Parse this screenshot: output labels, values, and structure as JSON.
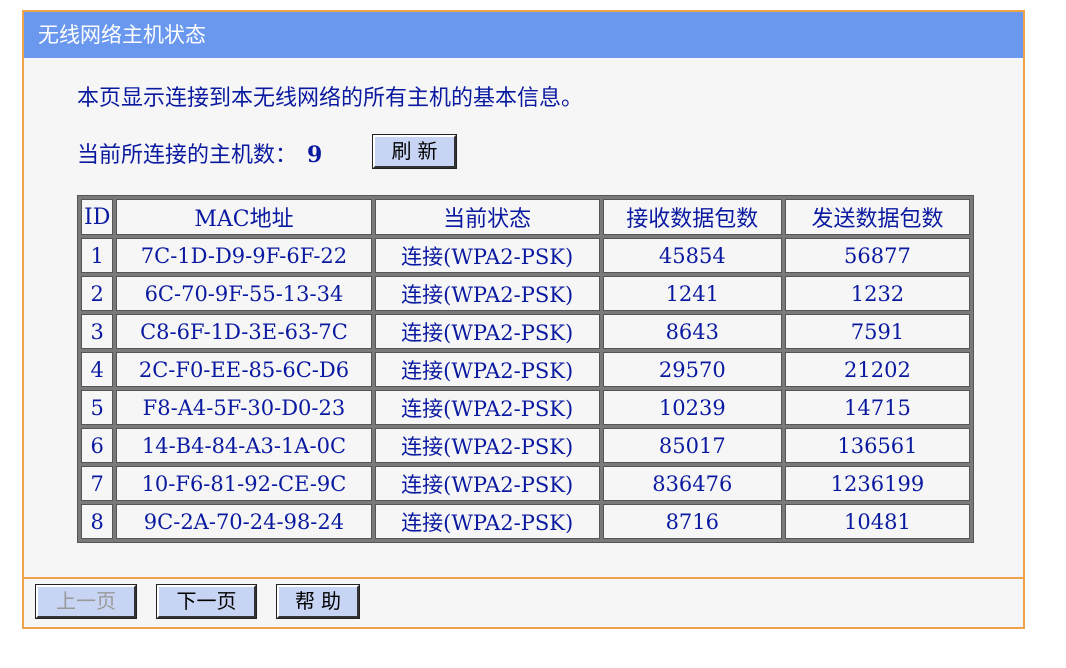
{
  "window": {
    "title": "无线网络主机状态"
  },
  "intro": {
    "description": "本页显示连接到本无线网络的所有主机的基本信息。",
    "count_label": "当前所连接的主机数：",
    "count_value": "9",
    "refresh_label": "刷新"
  },
  "table": {
    "headers": [
      "ID",
      "MAC地址",
      "当前状态",
      "接收数据包数",
      "发送数据包数"
    ],
    "rows": [
      [
        "1",
        "7C-1D-D9-9F-6F-22",
        "连接(WPA2-PSK)",
        "45854",
        "56877"
      ],
      [
        "2",
        "6C-70-9F-55-13-34",
        "连接(WPA2-PSK)",
        "1241",
        "1232"
      ],
      [
        "3",
        "C8-6F-1D-3E-63-7C",
        "连接(WPA2-PSK)",
        "8643",
        "7591"
      ],
      [
        "4",
        "2C-F0-EE-85-6C-D6",
        "连接(WPA2-PSK)",
        "29570",
        "21202"
      ],
      [
        "5",
        "F8-A4-5F-30-D0-23",
        "连接(WPA2-PSK)",
        "10239",
        "14715"
      ],
      [
        "6",
        "14-B4-84-A3-1A-0C",
        "连接(WPA2-PSK)",
        "85017",
        "136561"
      ],
      [
        "7",
        "10-F6-81-92-CE-9C",
        "连接(WPA2-PSK)",
        "836476",
        "1236199"
      ],
      [
        "8",
        "9C-2A-70-24-98-24",
        "连接(WPA2-PSK)",
        "8716",
        "10481"
      ]
    ]
  },
  "footer": {
    "prev_label": "上一页",
    "next_label": "下一页",
    "help_label": "帮助",
    "prev_disabled": true
  },
  "colors": {
    "title_bar": "#6b98ef",
    "frame_border": "#f0a24a",
    "text": "#0a1aa0",
    "button_bg": "#c8d4f3",
    "panel_bg": "#f7f6f6"
  }
}
